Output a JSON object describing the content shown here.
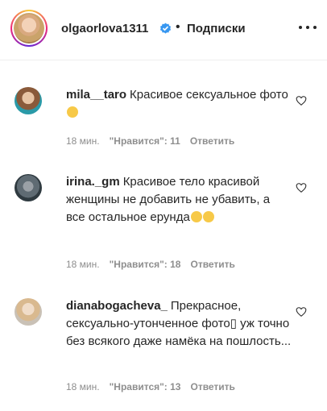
{
  "header": {
    "username": "olgaorlova1311",
    "separator": "•",
    "follow_label": "Подписки"
  },
  "comments": [
    {
      "user": "mila__taro",
      "text": "Красивое сексуальное фото",
      "emojis": [
        "heart-eyes"
      ],
      "time": "18 мин.",
      "likes": "\"Нравится\": 11",
      "reply": "Ответить"
    },
    {
      "user": "irina._gm",
      "text": "Красивое тело красивой женщины не добавить не убавить, а все остальное ерунда",
      "emojis": [
        "smirk",
        "grin"
      ],
      "time": "18 мин.",
      "likes": "\"Нравится\": 18",
      "reply": "Ответить"
    },
    {
      "user": "dianabogacheva_",
      "text": "Прекрасное, сексуально-утонченное фото▯ уж точно без всякого даже намёка на пошлость...",
      "emojis": [],
      "time": "18 мин.",
      "likes": "\"Нравится\": 13",
      "reply": "Ответить"
    }
  ],
  "colors": {
    "text": "#262626",
    "meta": "#8e8e8e",
    "verified": "#3897f0",
    "emoji": "#f7c948"
  }
}
